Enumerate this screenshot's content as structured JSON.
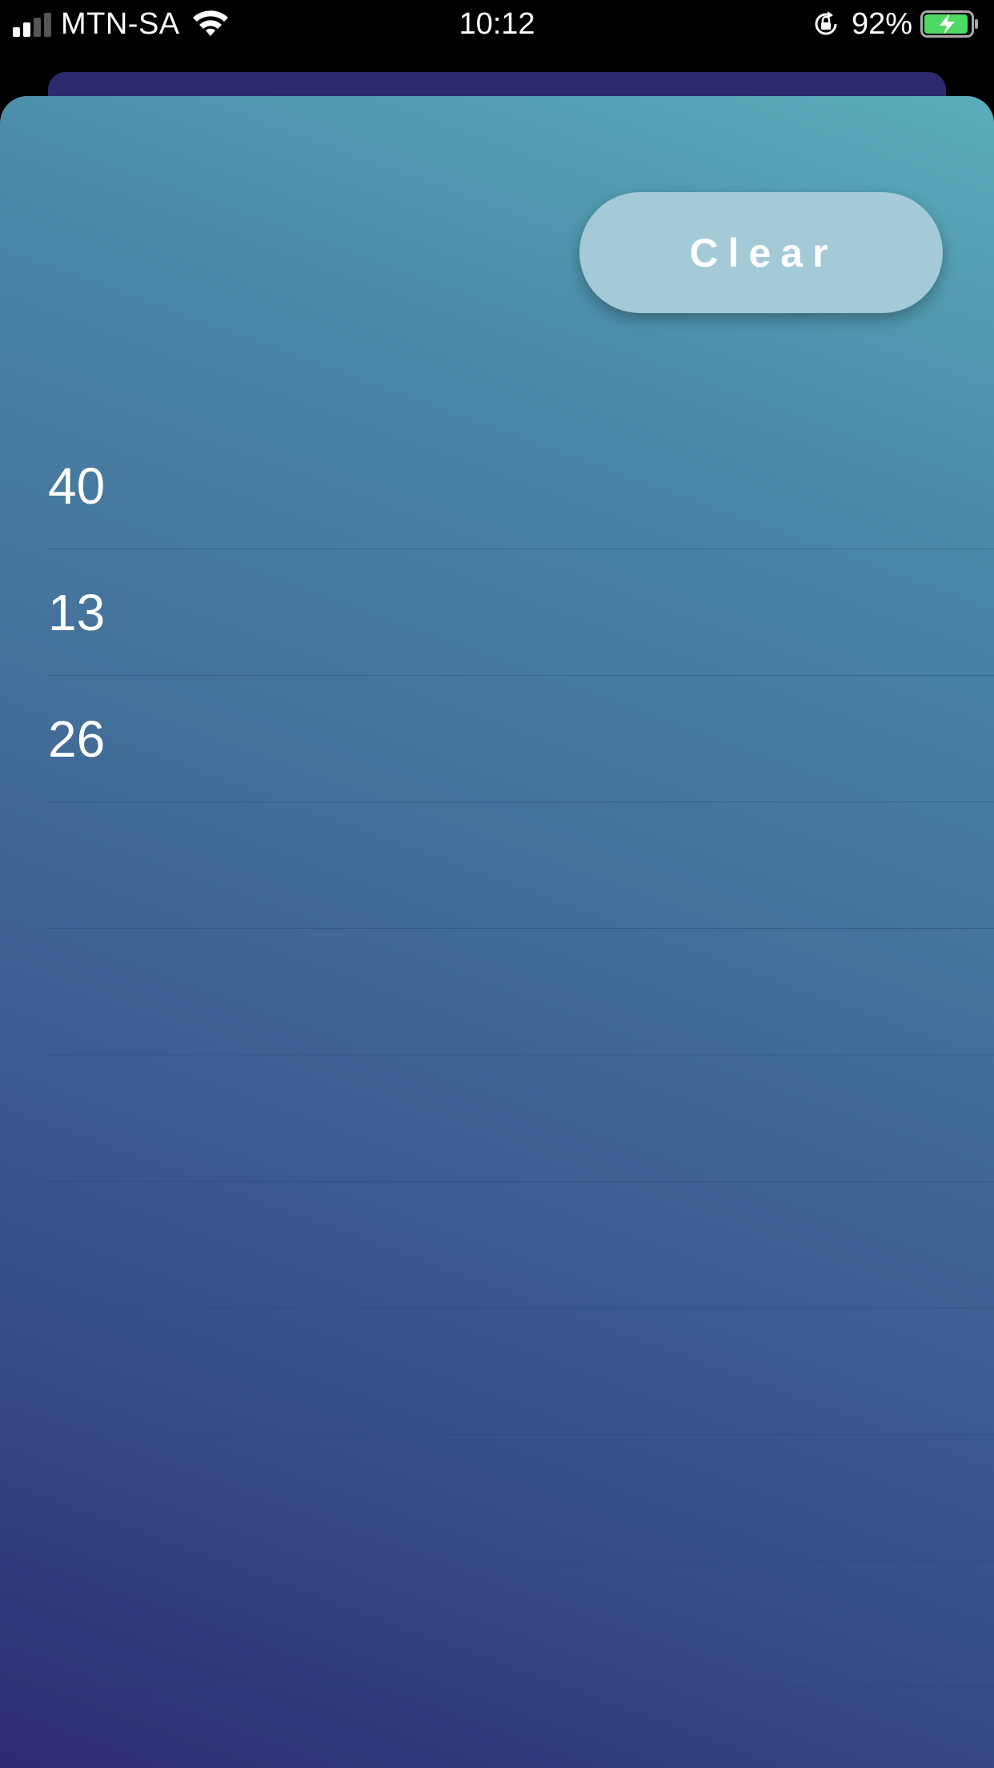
{
  "status_bar": {
    "carrier": "MTN-SA",
    "time": "10:12",
    "battery_percent": "92%",
    "icons": [
      "signal-icon",
      "wifi-icon",
      "rotation-lock-icon",
      "battery-charging-icon"
    ]
  },
  "main": {
    "clear_label": "Clear",
    "entries": [
      "40",
      "13",
      "26",
      "",
      "",
      "",
      "",
      "",
      "",
      "",
      ""
    ]
  },
  "colors": {
    "gradient_top": "#5aaebb",
    "gradient_bottom": "#2e2a72",
    "button_bg": "#a3cad6",
    "battery_fill": "#4cd964"
  }
}
